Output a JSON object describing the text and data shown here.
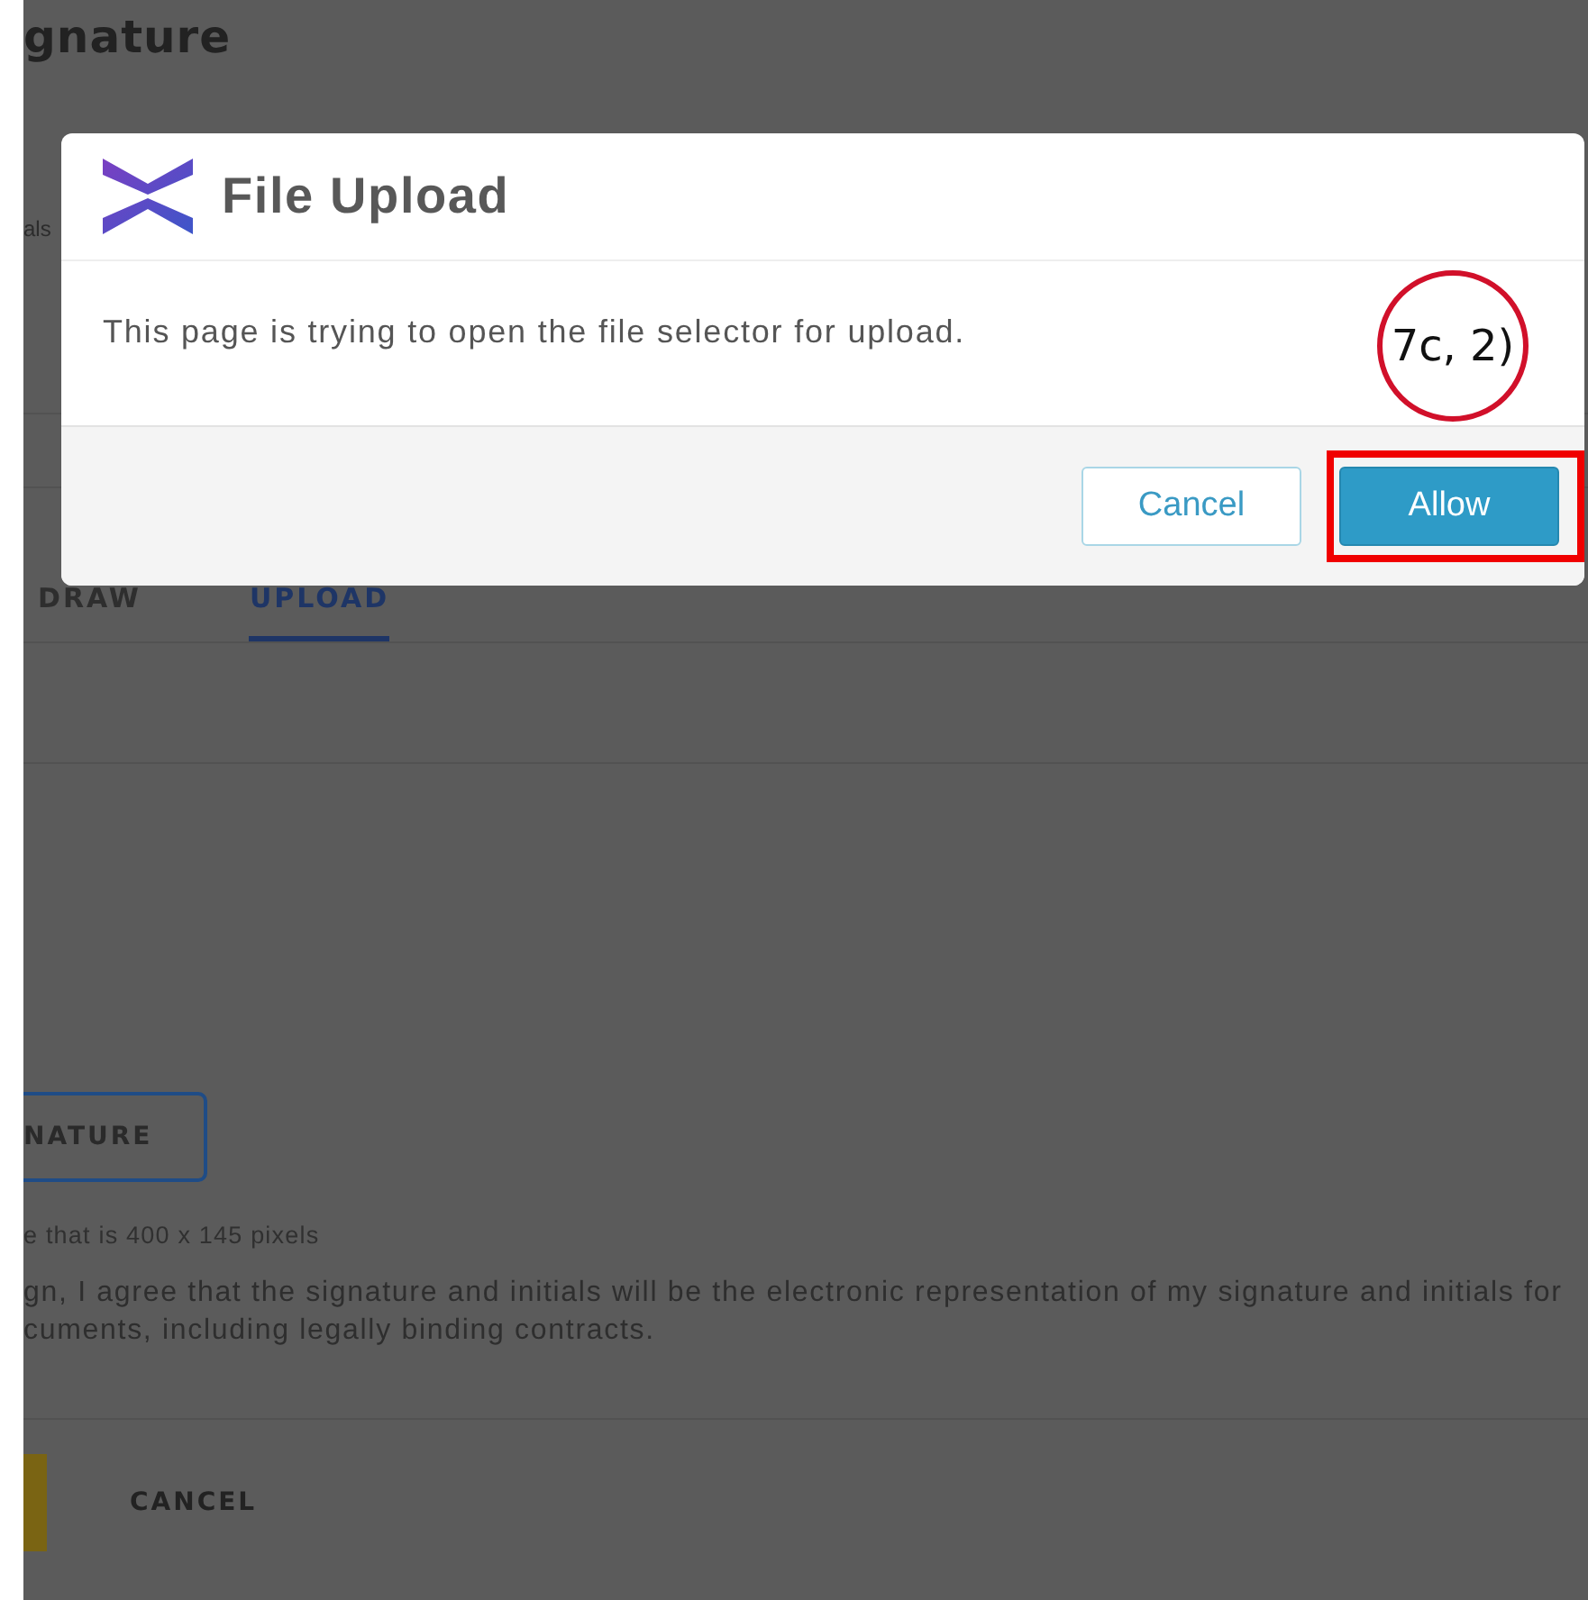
{
  "page": {
    "title": "gnature",
    "label_fragment": "als",
    "tabs": [
      {
        "label": "DRAW",
        "selected": false
      },
      {
        "label": "UPLOAD",
        "selected": true
      }
    ],
    "upload_button": "NATURE",
    "size_hint": "e that is 400 x 145 pixels",
    "agreement_lines": [
      "gn, I agree that the signature and initials will be the electronic representation of my signature and initials for",
      "cuments, including legally binding contracts."
    ],
    "cancel_button": "CANCEL"
  },
  "dialog": {
    "title": "File Upload",
    "message": "This page is trying to open the file selector for upload.",
    "buttons": [
      {
        "label": "Cancel",
        "kind": "secondary",
        "highlighted": false
      },
      {
        "label": "Allow",
        "kind": "primary",
        "highlighted": true
      }
    ]
  },
  "annotation": {
    "callout": "7c, 2)"
  }
}
